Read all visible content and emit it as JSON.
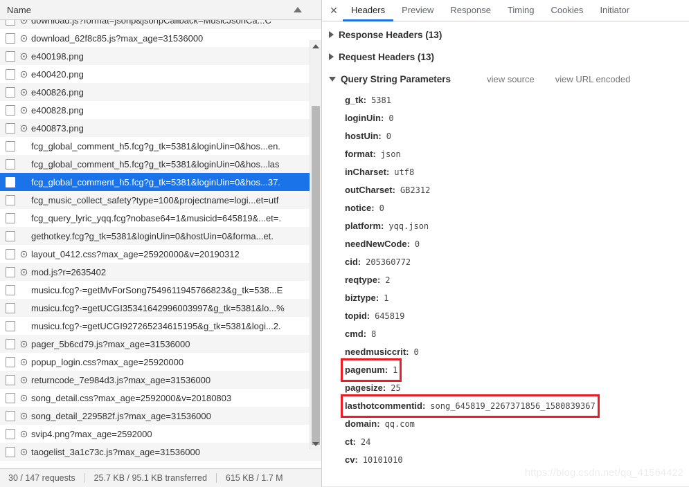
{
  "network_list": {
    "column_header": "Name",
    "sort_indicator": "ascending",
    "rows": [
      {
        "name": "download.js?format=jsonp&jsonpCallback=MusicJsonCa...C",
        "has_icon": true,
        "selected": false
      },
      {
        "name": "download_62f8c85.js?max_age=31536000",
        "has_icon": true,
        "selected": false
      },
      {
        "name": "e400198.png",
        "has_icon": true,
        "selected": false
      },
      {
        "name": "e400420.png",
        "has_icon": true,
        "selected": false
      },
      {
        "name": "e400826.png",
        "has_icon": true,
        "selected": false
      },
      {
        "name": "e400828.png",
        "has_icon": true,
        "selected": false
      },
      {
        "name": "e400873.png",
        "has_icon": true,
        "selected": false
      },
      {
        "name": "fcg_global_comment_h5.fcg?g_tk=5381&loginUin=0&hos...en.",
        "has_icon": false,
        "selected": false
      },
      {
        "name": "fcg_global_comment_h5.fcg?g_tk=5381&loginUin=0&hos...las",
        "has_icon": false,
        "selected": false
      },
      {
        "name": "fcg_global_comment_h5.fcg?g_tk=5381&loginUin=0&hos...37.",
        "has_icon": false,
        "selected": true
      },
      {
        "name": "fcg_music_collect_safety?type=100&projectname=logi...et=utf",
        "has_icon": false,
        "selected": false
      },
      {
        "name": "fcg_query_lyric_yqq.fcg?nobase64=1&musicid=645819&...et=.",
        "has_icon": false,
        "selected": false
      },
      {
        "name": "gethotkey.fcg?g_tk=5381&loginUin=0&hostUin=0&forma...et.",
        "has_icon": false,
        "selected": false
      },
      {
        "name": "layout_0412.css?max_age=25920000&v=20190312",
        "has_icon": true,
        "selected": false
      },
      {
        "name": "mod.js?r=2635402",
        "has_icon": true,
        "selected": false
      },
      {
        "name": "musicu.fcg?-=getMvForSong7549611945766823&g_tk=538...E",
        "has_icon": false,
        "selected": false
      },
      {
        "name": "musicu.fcg?-=getUCGI35341642996003997&g_tk=5381&lo...%",
        "has_icon": false,
        "selected": false
      },
      {
        "name": "musicu.fcg?-=getUCGI927265234615195&g_tk=5381&logi...2.",
        "has_icon": false,
        "selected": false
      },
      {
        "name": "pager_5b6cd79.js?max_age=31536000",
        "has_icon": true,
        "selected": false
      },
      {
        "name": "popup_login.css?max_age=25920000",
        "has_icon": true,
        "selected": false
      },
      {
        "name": "returncode_7e984d3.js?max_age=31536000",
        "has_icon": true,
        "selected": false
      },
      {
        "name": "song_detail.css?max_age=2592000&v=20180803",
        "has_icon": true,
        "selected": false
      },
      {
        "name": "song_detail_229582f.js?max_age=31536000",
        "has_icon": true,
        "selected": false
      },
      {
        "name": "svip4.png?max_age=2592000",
        "has_icon": true,
        "selected": false
      },
      {
        "name": "taogelist_3a1c73c.js?max_age=31536000",
        "has_icon": true,
        "selected": false
      }
    ],
    "status_bar": {
      "requests": "30 / 147 requests",
      "transferred": "25.7 KB / 95.1 KB transferred",
      "resources": "615 KB / 1.7 M"
    }
  },
  "details": {
    "close_label": "✕",
    "tabs": [
      {
        "label": "Headers",
        "active": true
      },
      {
        "label": "Preview",
        "active": false
      },
      {
        "label": "Response",
        "active": false
      },
      {
        "label": "Timing",
        "active": false
      },
      {
        "label": "Cookies",
        "active": false
      },
      {
        "label": "Initiator",
        "active": false
      }
    ],
    "sections": [
      {
        "title": "Response Headers (13)",
        "expanded": false
      },
      {
        "title": "Request Headers (13)",
        "expanded": false
      }
    ],
    "query_section": {
      "title": "Query String Parameters",
      "expanded": true,
      "view_source_label": "view source",
      "view_url_encoded_label": "view URL encoded"
    },
    "query_params": [
      {
        "key": "g_tk:",
        "value": "5381",
        "highlight": false
      },
      {
        "key": "loginUin:",
        "value": "0",
        "highlight": false
      },
      {
        "key": "hostUin:",
        "value": "0",
        "highlight": false
      },
      {
        "key": "format:",
        "value": "json",
        "highlight": false
      },
      {
        "key": "inCharset:",
        "value": "utf8",
        "highlight": false
      },
      {
        "key": "outCharset:",
        "value": "GB2312",
        "highlight": false
      },
      {
        "key": "notice:",
        "value": "0",
        "highlight": false
      },
      {
        "key": "platform:",
        "value": "yqq.json",
        "highlight": false
      },
      {
        "key": "needNewCode:",
        "value": "0",
        "highlight": false
      },
      {
        "key": "cid:",
        "value": "205360772",
        "highlight": false
      },
      {
        "key": "reqtype:",
        "value": "2",
        "highlight": false
      },
      {
        "key": "biztype:",
        "value": "1",
        "highlight": false
      },
      {
        "key": "topid:",
        "value": "645819",
        "highlight": false
      },
      {
        "key": "cmd:",
        "value": "8",
        "highlight": false
      },
      {
        "key": "needmusiccrit:",
        "value": "0",
        "highlight": false
      },
      {
        "key": "pagenum:",
        "value": "1",
        "highlight": true
      },
      {
        "key": "pagesize:",
        "value": "25",
        "highlight": false
      },
      {
        "key": "lasthotcommentid:",
        "value": "song_645819_2267371856_1580839367",
        "highlight": true
      },
      {
        "key": "domain:",
        "value": "qq.com",
        "highlight": false
      },
      {
        "key": "ct:",
        "value": "24",
        "highlight": false
      },
      {
        "key": "cv:",
        "value": "10101010",
        "highlight": false
      }
    ]
  },
  "watermark": "https://blog.csdn.net/qq_41564422",
  "colors": {
    "selection_blue": "#1a73e8",
    "highlight_red": "#ec1c24",
    "row_alt": "#f5f5f5",
    "chrome_gray": "#f3f3f3"
  }
}
